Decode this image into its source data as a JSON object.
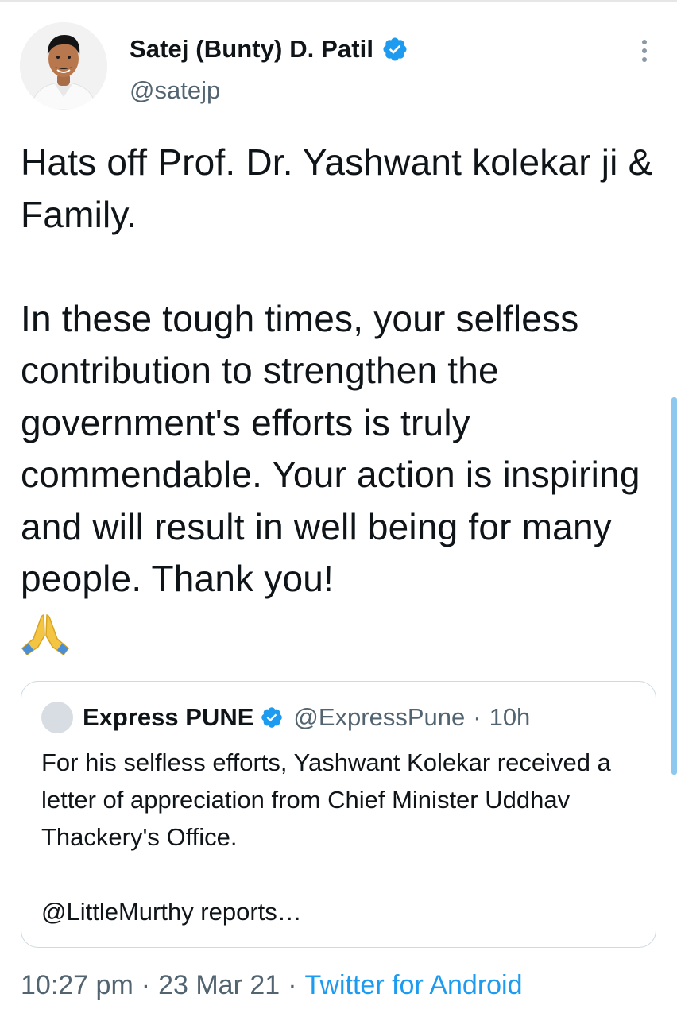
{
  "tweet": {
    "author_name": "Satej (Bunty) D. Patil",
    "author_handle": "@satejp",
    "text": "Hats off Prof. Dr. Yashwant kolekar ji & Family.\n\nIn these tough times, your selfless contribution to strengthen the government's efforts is truly commendable. Your action is inspiring and will result in well being for many people. Thank you!",
    "emoji_icon": "folded-hands-emoji",
    "timestamp_time": "10:27 pm",
    "timestamp_date": "23 Mar 21",
    "source": "Twitter for Android",
    "separator": "·"
  },
  "quote": {
    "author_name": "Express PUNE",
    "author_handle": "@ExpressPune",
    "separator": "·",
    "time": "10h",
    "text": "For his selfless efforts, Yashwant Kolekar received a letter of appreciation from Chief Minister Uddhav Thackery's Office.\n\n@LittleMurthy reports…"
  },
  "icons": {
    "verified": "verified-badge-icon",
    "more": "more-options-icon"
  },
  "colors": {
    "primary_text": "#0f1419",
    "secondary_text": "#536471",
    "link_blue": "#1d9bf0",
    "border": "#cfd9de"
  }
}
